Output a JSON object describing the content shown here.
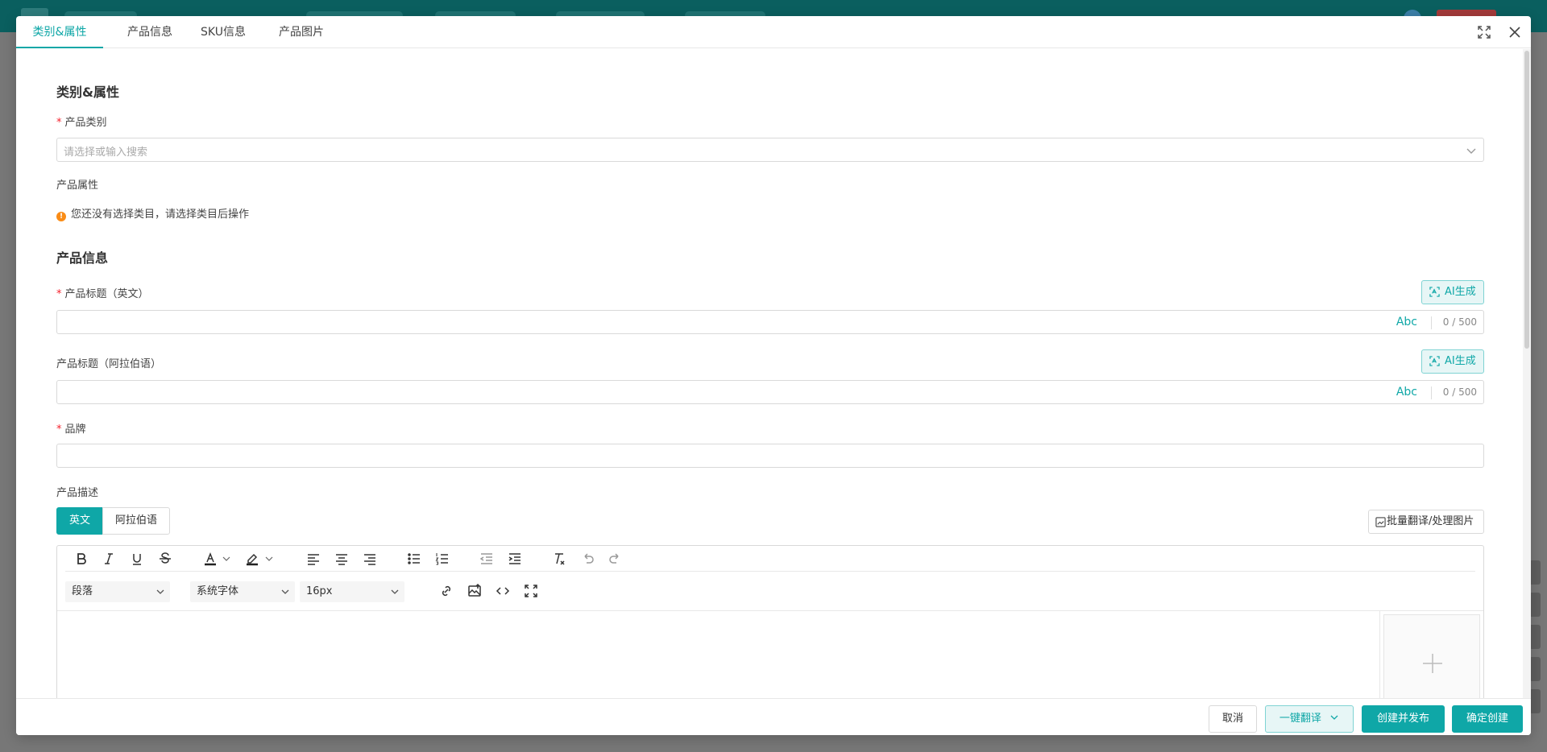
{
  "tabs": [
    {
      "label": "类别&属性",
      "active": true
    },
    {
      "label": "产品信息",
      "active": false
    },
    {
      "label": "SKU信息",
      "active": false
    },
    {
      "label": "产品图片",
      "active": false
    }
  ],
  "category": {
    "section_title": "类别&属性",
    "category_label": "产品类别",
    "category_placeholder": "请选择或输入搜索",
    "attr_label": "产品属性",
    "attr_warning": "您还没有选择类目，请选择类目后操作"
  },
  "product_info": {
    "section_title": "产品信息",
    "title_en_label": "产品标题（英文）",
    "title_ar_label": "产品标题（阿拉伯语）",
    "ai_button": "AI生成",
    "abc": "Abc",
    "count": "0 / 500",
    "brand_label": "品牌",
    "desc_label": "产品描述",
    "lang_en": "英文",
    "lang_ar": "阿拉伯语",
    "batch_button": "批量翻译/处理图片"
  },
  "editor": {
    "paragraph": "段落",
    "font_family": "系统字体",
    "font_size": "16px"
  },
  "footer": {
    "cancel": "取消",
    "translate": "一键翻译",
    "create_publish": "创建并发布",
    "confirm_create": "确定创建"
  },
  "colors": {
    "accent": "#0fa7a7",
    "header_bg": "#0a5f5f",
    "required": "#f5222d",
    "warning": "#fa8c16"
  }
}
